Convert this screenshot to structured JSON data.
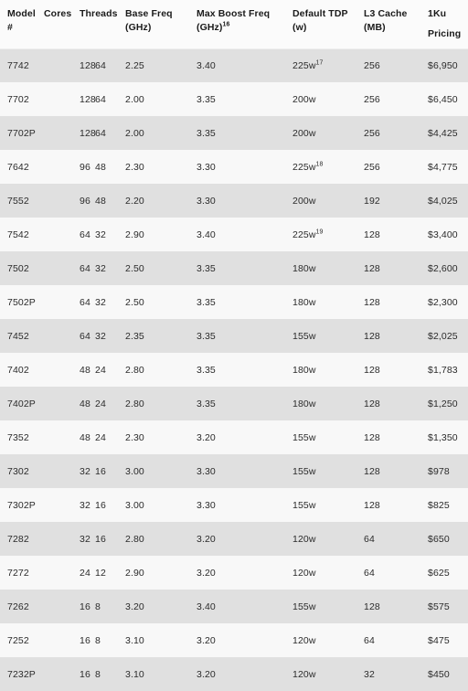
{
  "table": {
    "name": "amd-epyc-7002-series-specifications",
    "columns": [
      {
        "key": "model",
        "line1": "Model",
        "line2": "#",
        "sup": ""
      },
      {
        "key": "cores",
        "line1": "Cores",
        "line2": "",
        "sup": ""
      },
      {
        "key": "threads",
        "line1": "Threads",
        "line2": "",
        "sup": ""
      },
      {
        "key": "base",
        "line1": "Base Freq",
        "line2": "(GHz)",
        "sup": ""
      },
      {
        "key": "boost",
        "line1": "Max Boost Freq",
        "line2": "(GHz)",
        "sup": "16"
      },
      {
        "key": "tdp",
        "line1": "Default TDP",
        "line2": "(w)",
        "sup": ""
      },
      {
        "key": "l3",
        "line1": "L3 Cache",
        "line2": "(MB)",
        "sup": ""
      },
      {
        "key": "price",
        "line1": "1Ku",
        "line2": "Pricing",
        "sup": ""
      }
    ],
    "rows": [
      {
        "model": "7742",
        "cores": "64",
        "threads": "128",
        "base": "2.25",
        "boost": "3.40",
        "tdp": "225w",
        "tdp_sup": "17",
        "l3": "256",
        "price": "$6,950"
      },
      {
        "model": "7702",
        "cores": "64",
        "threads": "128",
        "base": "2.00",
        "boost": "3.35",
        "tdp": "200w",
        "tdp_sup": "",
        "l3": "256",
        "price": "$6,450"
      },
      {
        "model": "7702P",
        "cores": "64",
        "threads": "128",
        "base": "2.00",
        "boost": "3.35",
        "tdp": "200w",
        "tdp_sup": "",
        "l3": "256",
        "price": "$4,425"
      },
      {
        "model": "7642",
        "cores": "48",
        "threads": "96",
        "base": "2.30",
        "boost": "3.30",
        "tdp": "225w",
        "tdp_sup": "18",
        "l3": "256",
        "price": "$4,775"
      },
      {
        "model": "7552",
        "cores": "48",
        "threads": "96",
        "base": "2.20",
        "boost": "3.30",
        "tdp": "200w",
        "tdp_sup": "",
        "l3": "192",
        "price": "$4,025"
      },
      {
        "model": "7542",
        "cores": "32",
        "threads": "64",
        "base": "2.90",
        "boost": "3.40",
        "tdp": "225w",
        "tdp_sup": "19",
        "l3": "128",
        "price": "$3,400"
      },
      {
        "model": "7502",
        "cores": "32",
        "threads": "64",
        "base": "2.50",
        "boost": "3.35",
        "tdp": "180w",
        "tdp_sup": "",
        "l3": "128",
        "price": "$2,600"
      },
      {
        "model": "7502P",
        "cores": "32",
        "threads": "64",
        "base": "2.50",
        "boost": "3.35",
        "tdp": "180w",
        "tdp_sup": "",
        "l3": "128",
        "price": "$2,300"
      },
      {
        "model": "7452",
        "cores": "32",
        "threads": "64",
        "base": "2.35",
        "boost": "3.35",
        "tdp": "155w",
        "tdp_sup": "",
        "l3": "128",
        "price": "$2,025"
      },
      {
        "model": "7402",
        "cores": "24",
        "threads": "48",
        "base": "2.80",
        "boost": "3.35",
        "tdp": "180w",
        "tdp_sup": "",
        "l3": "128",
        "price": "$1,783"
      },
      {
        "model": "7402P",
        "cores": "24",
        "threads": "48",
        "base": "2.80",
        "boost": "3.35",
        "tdp": "180w",
        "tdp_sup": "",
        "l3": "128",
        "price": "$1,250"
      },
      {
        "model": "7352",
        "cores": "24",
        "threads": "48",
        "base": "2.30",
        "boost": "3.20",
        "tdp": "155w",
        "tdp_sup": "",
        "l3": "128",
        "price": "$1,350"
      },
      {
        "model": "7302",
        "cores": "16",
        "threads": "32",
        "base": "3.00",
        "boost": "3.30",
        "tdp": "155w",
        "tdp_sup": "",
        "l3": "128",
        "price": "$978"
      },
      {
        "model": "7302P",
        "cores": "16",
        "threads": "32",
        "base": "3.00",
        "boost": "3.30",
        "tdp": "155w",
        "tdp_sup": "",
        "l3": "128",
        "price": "$825"
      },
      {
        "model": "7282",
        "cores": "16",
        "threads": "32",
        "base": "2.80",
        "boost": "3.20",
        "tdp": "120w",
        "tdp_sup": "",
        "l3": "64",
        "price": "$650"
      },
      {
        "model": "7272",
        "cores": "12",
        "threads": "24",
        "base": "2.90",
        "boost": "3.20",
        "tdp": "120w",
        "tdp_sup": "",
        "l3": "64",
        "price": "$625"
      },
      {
        "model": "7262",
        "cores": "8",
        "threads": "16",
        "base": "3.20",
        "boost": "3.40",
        "tdp": "155w",
        "tdp_sup": "",
        "l3": "128",
        "price": "$575"
      },
      {
        "model": "7252",
        "cores": "8",
        "threads": "16",
        "base": "3.10",
        "boost": "3.20",
        "tdp": "120w",
        "tdp_sup": "",
        "l3": "64",
        "price": "$475"
      },
      {
        "model": "7232P",
        "cores": "8",
        "threads": "16",
        "base": "3.10",
        "boost": "3.20",
        "tdp": "120w",
        "tdp_sup": "",
        "l3": "32",
        "price": "$450"
      }
    ]
  },
  "colors": {
    "header_bg": "#fbfbfb",
    "row_even_bg": "#e0e0e0",
    "row_odd_bg": "#f8f8f8",
    "header_text": "#1a1a1a",
    "body_text": "#2b2b2b",
    "divider": "#eeeeee"
  }
}
